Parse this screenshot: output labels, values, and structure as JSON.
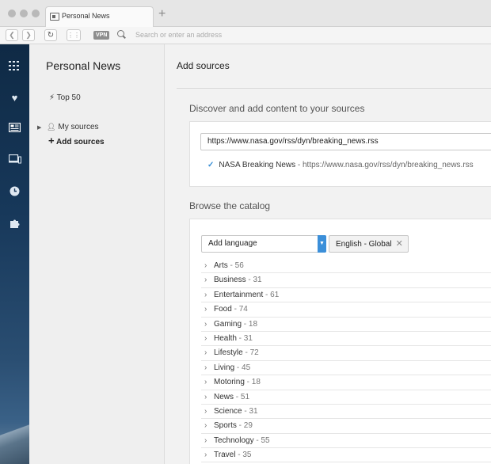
{
  "browser": {
    "tab_title": "Personal News",
    "new_tab_symbol": "+",
    "vpn_label": "VPN",
    "address_placeholder": "Search or enter an address"
  },
  "icons": {
    "speed_dial": "grid-icon",
    "bookmarks": "heart-icon",
    "news": "news-icon",
    "devices": "devices-icon",
    "history": "clock-icon",
    "extensions": "puzzle-icon"
  },
  "panel": {
    "title": "Personal News",
    "top50": "Top 50",
    "my_sources": "My sources",
    "add_sources": "Add sources"
  },
  "main": {
    "title": "Add sources",
    "discover_title": "Discover and add content to your sources",
    "url_value": "https://www.nasa.gov/rss/dyn/breaking_news.rss",
    "result_name": "NASA Breaking News",
    "result_url": "https://www.nasa.gov/rss/dyn/breaking_news.rss",
    "catalog_title": "Browse the catalog",
    "language_select": "Add language",
    "language_chip": "English - Global",
    "accent_color": "#3b8fd9"
  },
  "catalog": [
    {
      "name": "Arts",
      "count": "56"
    },
    {
      "name": "Business",
      "count": "31"
    },
    {
      "name": "Entertainment",
      "count": "61"
    },
    {
      "name": "Food",
      "count": "74"
    },
    {
      "name": "Gaming",
      "count": "18"
    },
    {
      "name": "Health",
      "count": "31"
    },
    {
      "name": "Lifestyle",
      "count": "72"
    },
    {
      "name": "Living",
      "count": "45"
    },
    {
      "name": "Motoring",
      "count": "18"
    },
    {
      "name": "News",
      "count": "51"
    },
    {
      "name": "Science",
      "count": "31"
    },
    {
      "name": "Sports",
      "count": "29"
    },
    {
      "name": "Technology",
      "count": "55"
    },
    {
      "name": "Travel",
      "count": "35"
    }
  ]
}
